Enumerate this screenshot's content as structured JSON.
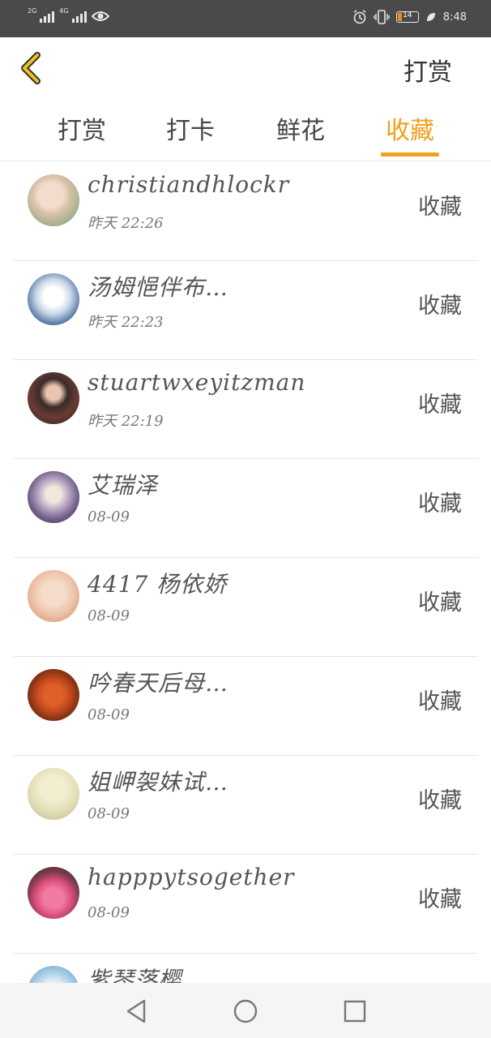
{
  "status_bar": {
    "net1": "2G",
    "net2": "4G",
    "battery": "14",
    "time": "8:48"
  },
  "header": {
    "title": "打赏"
  },
  "tabs": [
    {
      "label": "打赏"
    },
    {
      "label": "打卡"
    },
    {
      "label": "鲜花"
    },
    {
      "label": "收藏",
      "active": true
    }
  ],
  "colors": {
    "accent": "#f0a01c",
    "statusbar": "#4a4a4a"
  },
  "rows": [
    {
      "name": "christiandhlockr",
      "time": "昨天 22:26",
      "action": "收藏",
      "avatar": "avatar-person-green"
    },
    {
      "name": "汤姆悒伴布…",
      "time": "昨天 22:23",
      "action": "收藏",
      "avatar": "avatar-snow-tree"
    },
    {
      "name": "stuartwxeyitzman",
      "time": "昨天 22:19",
      "action": "收藏",
      "avatar": "avatar-girl-dark-hair"
    },
    {
      "name": "艾瑞泽",
      "time": "08-09",
      "action": "收藏",
      "avatar": "avatar-anime-character"
    },
    {
      "name": "4417 杨依娇",
      "time": "08-09",
      "action": "收藏",
      "avatar": "avatar-woman-lying"
    },
    {
      "name": "吟春天后母…",
      "time": "08-09",
      "action": "收藏",
      "avatar": "avatar-food-dish"
    },
    {
      "name": "姐岬袈妹试…",
      "time": "08-09",
      "action": "收藏",
      "avatar": "avatar-foggy-landscape"
    },
    {
      "name": "happpytsogether",
      "time": "08-09",
      "action": "收藏",
      "avatar": "avatar-pink-car"
    },
    {
      "name": "紫琴落樱",
      "time": "",
      "action": "",
      "avatar": "avatar-blue-flowers"
    }
  ]
}
